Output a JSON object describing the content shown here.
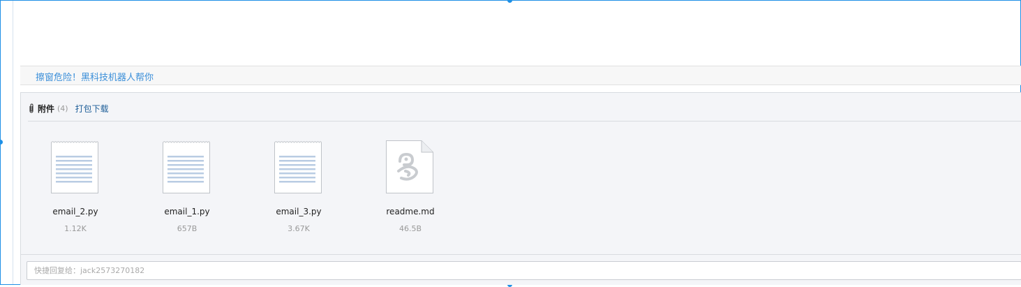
{
  "ad": {
    "text": "擦窗危险！黑科技机器人帮你"
  },
  "attachments": {
    "title": "附件",
    "count": "(4)",
    "download_all": "打包下载",
    "files": [
      {
        "name": "email_2.py",
        "size": "1.12K",
        "icon": "text-file-icon"
      },
      {
        "name": "email_1.py",
        "size": "657B",
        "icon": "text-file-icon"
      },
      {
        "name": "email_3.py",
        "size": "3.67K",
        "icon": "text-file-icon"
      },
      {
        "name": "readme.md",
        "size": "46.5B",
        "icon": "generic-file-icon"
      }
    ]
  },
  "reply": {
    "placeholder": "快捷回复给：jack2573270182"
  },
  "colors": {
    "selection": "#1e90e6",
    "link": "#3b8fd9",
    "panel_bg": "#f4f5f8"
  }
}
